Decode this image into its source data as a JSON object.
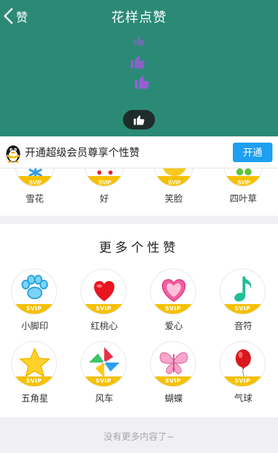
{
  "header": {
    "back_label": "赞",
    "title": "花样点赞",
    "bg_color": "#2b8a76",
    "thumb_color": "#9b5cd6"
  },
  "banner": {
    "text": "开通超级会员尊享个性赞",
    "button_label": "开通"
  },
  "section_top": {
    "items": [
      {
        "label": "雪花",
        "icon": "snowflake-icon"
      },
      {
        "label": "好",
        "icon": "good-icon"
      },
      {
        "label": "笑脸",
        "icon": "smiley-icon"
      },
      {
        "label": "四叶草",
        "icon": "clover-icon"
      }
    ]
  },
  "section_more": {
    "title": "更多个性赞",
    "badge": "SVIP",
    "items": [
      {
        "label": "小脚印",
        "icon": "paw-print-icon"
      },
      {
        "label": "红桃心",
        "icon": "red-heart-icon"
      },
      {
        "label": "爱心",
        "icon": "pink-heart-icon"
      },
      {
        "label": "音符",
        "icon": "music-note-icon"
      },
      {
        "label": "五角星",
        "icon": "star-icon"
      },
      {
        "label": "风车",
        "icon": "pinwheel-icon"
      },
      {
        "label": "蝴蝶",
        "icon": "butterfly-icon"
      },
      {
        "label": "气球",
        "icon": "balloon-icon"
      }
    ]
  },
  "footer": {
    "text": "没有更多内容了~"
  }
}
